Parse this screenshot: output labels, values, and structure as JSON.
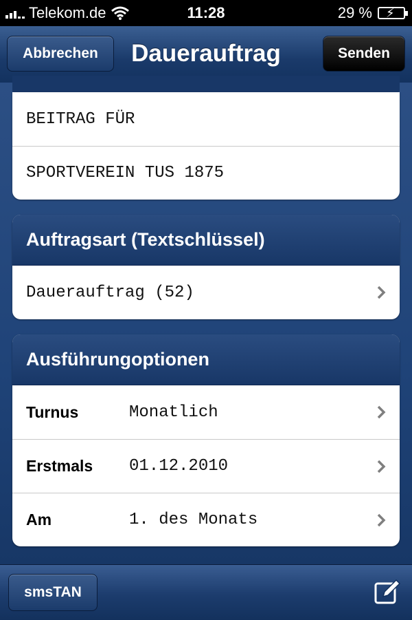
{
  "status_bar": {
    "carrier": "Telekom.de",
    "time": "11:28",
    "battery_percent": "29 %",
    "icons": [
      "signal-icon",
      "wifi-icon",
      "battery-charging-icon"
    ]
  },
  "navbar": {
    "cancel_label": "Abbrechen",
    "title": "Dauerauftrag",
    "send_label": "Senden"
  },
  "purpose_group": {
    "lines": [
      "BEITRAG FÜR",
      "SPORTVEREIN TUS 1875"
    ]
  },
  "order_type_group": {
    "header": "Auftragsart (Textschlüssel)",
    "value": "Dauerauftrag (52)"
  },
  "options_group": {
    "header": "Ausführungoptionen",
    "rows": [
      {
        "label": "Turnus",
        "value": "Monatlich"
      },
      {
        "label": "Erstmals",
        "value": "01.12.2010"
      },
      {
        "label": "Am",
        "value": "1. des Monats"
      }
    ]
  },
  "toolbar": {
    "smstan_label": "smsTAN",
    "compose_icon": "compose-icon"
  },
  "colors": {
    "nav_blue": "#1a3a6a",
    "background_blue": "#1f4378",
    "send_button": "#000000"
  }
}
